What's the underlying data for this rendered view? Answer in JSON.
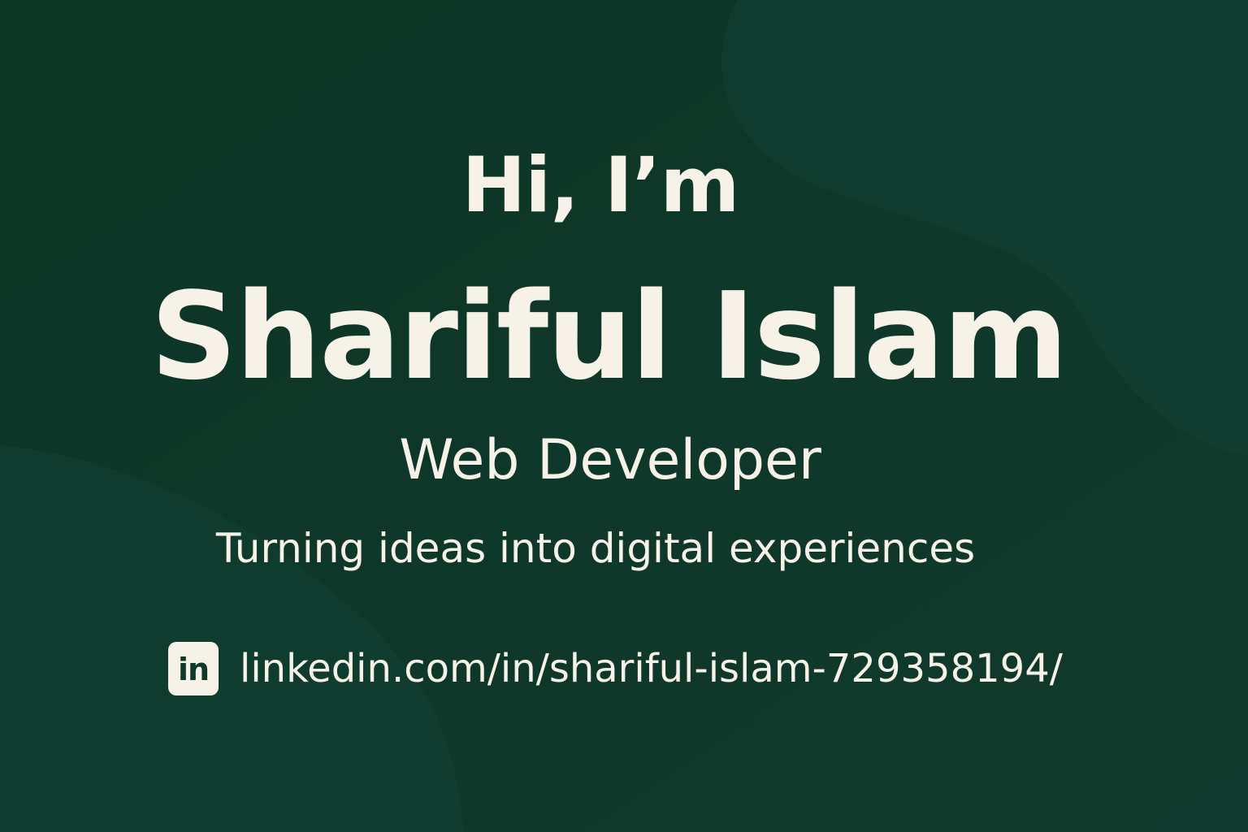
{
  "hero": {
    "greeting": "Hi, I’m",
    "name": "Shariful Islam",
    "role": "Web Developer",
    "tagline": "Turning ideas into digital experiences"
  },
  "social": {
    "linkedin_url": "linkedin.com/in/shariful-islam-729358194/",
    "linkedin_icon_text": "in",
    "icon": "linkedin-icon"
  },
  "colors": {
    "background": "#0f3a2b",
    "background_shape": "#123f31",
    "text": "#f6f2e7"
  }
}
